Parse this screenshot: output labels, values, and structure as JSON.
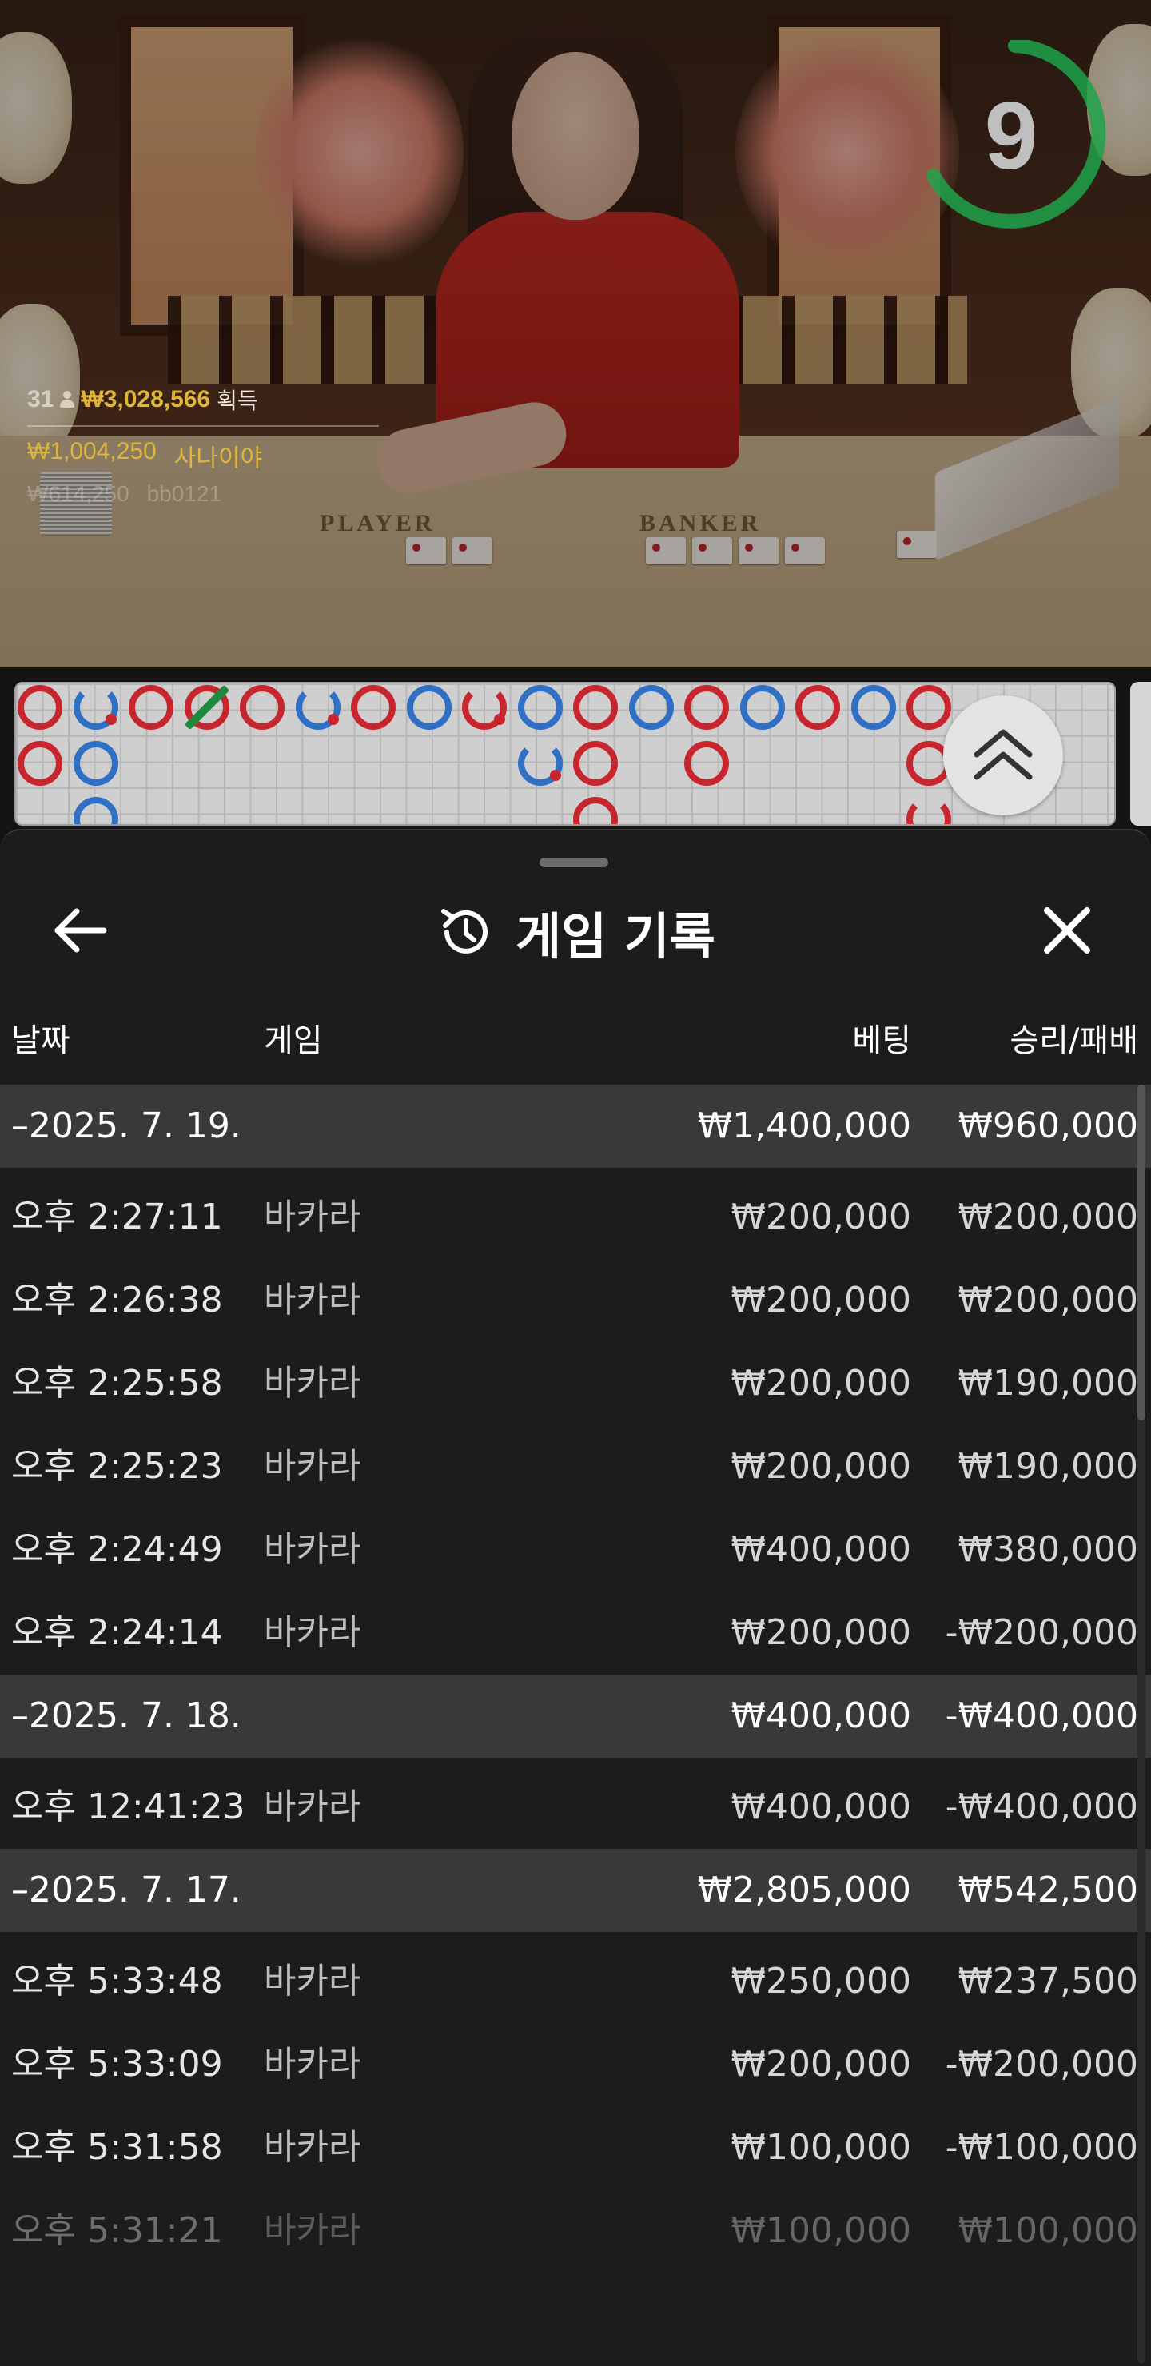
{
  "stream": {
    "table_labels": {
      "player": "PLAYER",
      "banker": "BANKER"
    },
    "countdown": "9",
    "win_summary": {
      "player_count": "31",
      "total_amount": "₩3,028,566",
      "total_label": "획득",
      "top_amount": "₩1,004,250",
      "top_player": "사나이야",
      "second_amount": "₩614,250",
      "second_player": "bb0121"
    },
    "colors": {
      "banker": "#c8262e",
      "player": "#2f6fc4",
      "tie": "#1d8a3e",
      "timer": "#1fa34a"
    }
  },
  "bead_road": {
    "columns": [
      [
        "banker",
        "banker"
      ],
      [
        "player",
        "player",
        "player"
      ],
      [
        "banker"
      ],
      [
        "tie"
      ],
      [
        "banker"
      ],
      [
        "player"
      ],
      [
        "banker"
      ],
      [
        "player"
      ],
      [
        "banker"
      ],
      [
        "player",
        "player"
      ],
      [
        "banker",
        "banker",
        "banker"
      ],
      [
        "player"
      ],
      [
        "banker",
        "banker"
      ],
      [
        "player"
      ],
      [
        "banker"
      ],
      [
        "player"
      ],
      [
        "banker",
        "banker",
        "banker"
      ]
    ]
  },
  "history": {
    "title": "게임 기록",
    "icons": {
      "back": "arrow-left-icon",
      "title": "history-icon",
      "close": "close-icon"
    },
    "columns": {
      "date": "날짜",
      "game": "게임",
      "bet": "베팅",
      "result": "승리/패배"
    },
    "rows": [
      {
        "type": "group",
        "date": "–2025. 7. 19.",
        "game": "",
        "bet": "₩1,400,000",
        "result": "₩960,000"
      },
      {
        "type": "item",
        "date": "오후 2:27:11",
        "game": "바카라",
        "bet": "₩200,000",
        "result": "₩200,000"
      },
      {
        "type": "item",
        "date": "오후 2:26:38",
        "game": "바카라",
        "bet": "₩200,000",
        "result": "₩200,000"
      },
      {
        "type": "item",
        "date": "오후 2:25:58",
        "game": "바카라",
        "bet": "₩200,000",
        "result": "₩190,000"
      },
      {
        "type": "item",
        "date": "오후 2:25:23",
        "game": "바카라",
        "bet": "₩200,000",
        "result": "₩190,000"
      },
      {
        "type": "item",
        "date": "오후 2:24:49",
        "game": "바카라",
        "bet": "₩400,000",
        "result": "₩380,000"
      },
      {
        "type": "item",
        "date": "오후 2:24:14",
        "game": "바카라",
        "bet": "₩200,000",
        "result": "-₩200,000"
      },
      {
        "type": "group",
        "date": "–2025. 7. 18.",
        "game": "",
        "bet": "₩400,000",
        "result": "-₩400,000"
      },
      {
        "type": "item",
        "date": "오후 12:41:23",
        "game": "바카라",
        "bet": "₩400,000",
        "result": "-₩400,000"
      },
      {
        "type": "group",
        "date": "–2025. 7. 17.",
        "game": "",
        "bet": "₩2,805,000",
        "result": "₩542,500"
      },
      {
        "type": "item",
        "date": "오후 5:33:48",
        "game": "바카라",
        "bet": "₩250,000",
        "result": "₩237,500"
      },
      {
        "type": "item",
        "date": "오후 5:33:09",
        "game": "바카라",
        "bet": "₩200,000",
        "result": "-₩200,000"
      },
      {
        "type": "item",
        "date": "오후 5:31:58",
        "game": "바카라",
        "bet": "₩100,000",
        "result": "-₩100,000"
      },
      {
        "type": "item",
        "date": "오후 5:31:21",
        "game": "바카라",
        "bet": "₩100,000",
        "result": "₩100,000"
      }
    ]
  }
}
